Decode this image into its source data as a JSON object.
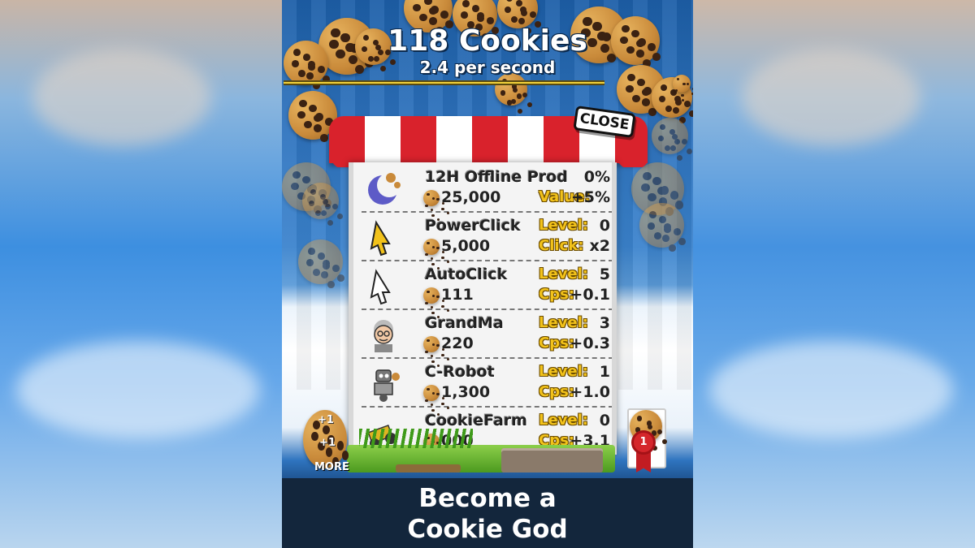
{
  "hud": {
    "cookie_count": "118 Cookies",
    "rate": "2.4 per second",
    "progress": 0.78
  },
  "shop": {
    "close_label": "CLOSE",
    "items": [
      {
        "name": "12H Offline Prod",
        "price": "25,000",
        "stat1_label": "",
        "stat1_value": "0%",
        "stat2_label": "Value:",
        "stat2_value": "+5%",
        "icon": "moon-icon"
      },
      {
        "name": "PowerClick",
        "price": "5,000",
        "stat1_label": "Level:",
        "stat1_value": "0",
        "stat2_label": "Click:",
        "stat2_value": "x2",
        "icon": "gold-cursor-icon"
      },
      {
        "name": "AutoClick",
        "price": "111",
        "stat1_label": "Level:",
        "stat1_value": "5",
        "stat2_label": "Cps:",
        "stat2_value": "+0.1",
        "icon": "cursor-icon"
      },
      {
        "name": "GrandMa",
        "price": "220",
        "stat1_label": "Level:",
        "stat1_value": "3",
        "stat2_label": "Cps:",
        "stat2_value": "+0.3",
        "icon": "grandma-icon"
      },
      {
        "name": "C-Robot",
        "price": "1,300",
        "stat1_label": "Level:",
        "stat1_value": "1",
        "stat2_label": "Cps:",
        "stat2_value": "+1.0",
        "icon": "robot-icon"
      },
      {
        "name": "CookieFarm",
        "price": "000",
        "stat1_label": "Level:",
        "stat1_value": "0",
        "stat2_label": "Cps:",
        "stat2_value": "+3.1",
        "icon": "tractor-icon"
      }
    ]
  },
  "footer": {
    "more_label": "MORE",
    "plus1": "+1",
    "plus2": "+1",
    "rank": "1"
  },
  "banner": {
    "line1": "Become a",
    "line2": "Cookie God"
  },
  "colors": {
    "awning_red": "#d9222c",
    "label_gold": "#f2c21a",
    "banner_bg": "#13263c"
  }
}
